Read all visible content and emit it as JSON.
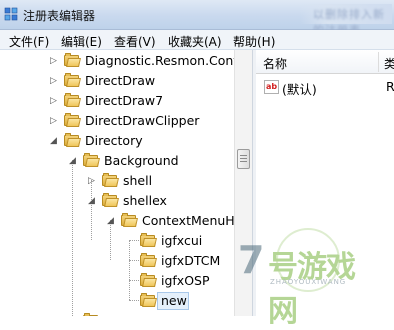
{
  "window": {
    "title": "注册表编辑器",
    "blurred_hint": "以删除排入新的注册表..."
  },
  "menu": [
    {
      "label": "文件(F)"
    },
    {
      "label": "编辑(E)"
    },
    {
      "label": "查看(V)"
    },
    {
      "label": "收藏夹(A)"
    },
    {
      "label": "帮助(H)"
    }
  ],
  "tree": {
    "items": [
      {
        "label": "Diagnostic.Resmon.Config",
        "level": 0,
        "expand": "collapsed"
      },
      {
        "label": "DirectDraw",
        "level": 0,
        "expand": "collapsed"
      },
      {
        "label": "DirectDraw7",
        "level": 0,
        "expand": "collapsed"
      },
      {
        "label": "DirectDrawClipper",
        "level": 0,
        "expand": "collapsed"
      },
      {
        "label": "Directory",
        "level": 0,
        "expand": "expanded"
      },
      {
        "label": "Background",
        "level": 1,
        "expand": "expanded"
      },
      {
        "label": "shell",
        "level": 2,
        "expand": "collapsed"
      },
      {
        "label": "shellex",
        "level": 2,
        "expand": "expanded"
      },
      {
        "label": "ContextMenuHa",
        "level": 3,
        "expand": "expanded"
      },
      {
        "label": "igfxcui",
        "level": 4,
        "expand": "none"
      },
      {
        "label": "igfxDTCM",
        "level": 4,
        "expand": "none"
      },
      {
        "label": "igfxOSP",
        "level": 4,
        "expand": "none"
      },
      {
        "label": "new",
        "level": 4,
        "expand": "none",
        "selected": true
      }
    ]
  },
  "list": {
    "columns": {
      "name": "名称",
      "type": "类"
    },
    "rows": [
      {
        "icon": "ab-string-icon",
        "icon_text": "ab",
        "name": "(默认)",
        "type": "R"
      }
    ]
  },
  "watermark": {
    "number": "7",
    "text": "号游戏网",
    "sub": "ZHAOYOUXIWANG"
  },
  "colors": {
    "folder": "#efc65a",
    "selection": "#e5f0fb",
    "titlebar": "#c9d9ee",
    "watermark_green": "#7ab541"
  }
}
